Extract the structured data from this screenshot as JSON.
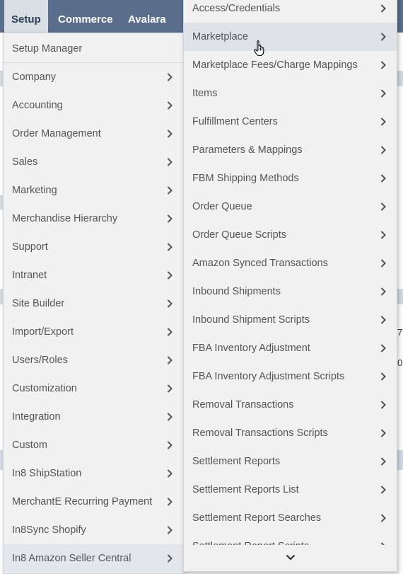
{
  "navbar": {
    "tabs": [
      "Setup",
      "Commerce",
      "Avalara"
    ],
    "active_tab": "Setup"
  },
  "background": {
    "edge_texts": [
      "7",
      "0"
    ]
  },
  "setup_menu": {
    "items": [
      "Setup Manager",
      "Company",
      "Accounting",
      "Order Management",
      "Sales",
      "Marketing",
      "Merchandise Hierarchy",
      "Support",
      "Intranet",
      "Site Builder",
      "Import/Export",
      "Users/Roles",
      "Customization",
      "Integration",
      "Custom",
      "In8 ShipStation",
      "MerchantE Recurring Payment",
      "In8Sync Shopify",
      "In8 Amazon Seller Central"
    ],
    "highlighted": "In8 Amazon Seller Central"
  },
  "submenu": {
    "items": [
      "Access/Credentials",
      "Marketplace",
      "Marketplace Fees/Charge Mappings",
      "Items",
      "Fulfillment Centers",
      "Parameters & Mappings",
      "FBM Shipping Methods",
      "Order Queue",
      "Order Queue Scripts",
      "Amazon Synced Transactions",
      "Inbound Shipments",
      "Inbound Shipment Scripts",
      "FBA Inventory Adjustment",
      "FBA Inventory Adjustment Scripts",
      "Removal Transactions",
      "Removal Transactions Scripts",
      "Settlement Reports",
      "Settlement Reports List",
      "Settlement Report Searches",
      "Settlement Report Scripts"
    ],
    "hovered": "Marketplace"
  },
  "colors": {
    "navbar": "#5a6f8c",
    "menu_bg": "#f1f1f1",
    "highlight": "#dfe3e8"
  },
  "icons": {
    "chevron": "chevron-right-icon",
    "scroll": "chevron-down-icon",
    "cursor": "hand-pointer-icon"
  }
}
